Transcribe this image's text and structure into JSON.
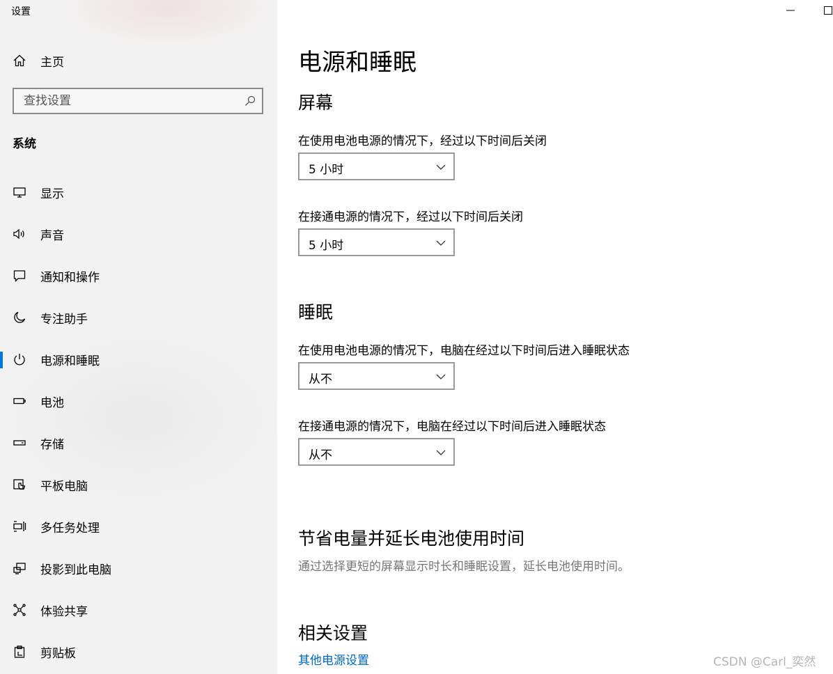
{
  "window": {
    "title": "设置"
  },
  "sidebar": {
    "home_label": "主页",
    "search_placeholder": "查找设置",
    "section_title": "系统",
    "items": [
      {
        "label": "显示",
        "icon": "display-icon"
      },
      {
        "label": "声音",
        "icon": "speaker-icon"
      },
      {
        "label": "通知和操作",
        "icon": "notification-icon"
      },
      {
        "label": "专注助手",
        "icon": "moon-icon"
      },
      {
        "label": "电源和睡眠",
        "icon": "power-icon",
        "active": true
      },
      {
        "label": "电池",
        "icon": "battery-icon"
      },
      {
        "label": "存储",
        "icon": "storage-icon"
      },
      {
        "label": "平板电脑",
        "icon": "tablet-icon"
      },
      {
        "label": "多任务处理",
        "icon": "multitask-icon"
      },
      {
        "label": "投影到此电脑",
        "icon": "project-icon"
      },
      {
        "label": "体验共享",
        "icon": "share-icon"
      },
      {
        "label": "剪贴板",
        "icon": "clipboard-icon"
      }
    ]
  },
  "main": {
    "title": "电源和睡眠",
    "screen": {
      "heading": "屏幕",
      "battery_label": "在使用电池电源的情况下，经过以下时间后关闭",
      "battery_value": "5 小时",
      "plugged_label": "在接通电源的情况下，经过以下时间后关闭",
      "plugged_value": "5 小时"
    },
    "sleep": {
      "heading": "睡眠",
      "battery_label": "在使用电池电源的情况下，电脑在经过以下时间后进入睡眠状态",
      "battery_value": "从不",
      "plugged_label": "在接通电源的情况下，电脑在经过以下时间后进入睡眠状态",
      "plugged_value": "从不"
    },
    "save": {
      "heading": "节省电量并延长电池使用时间",
      "description": "通过选择更短的屏幕显示时长和睡眠设置，延长电池使用时间。"
    },
    "related": {
      "heading": "相关设置",
      "link": "其他电源设置"
    }
  },
  "watermark": "CSDN @Carl_奕然",
  "colors": {
    "accent": "#0078d7",
    "link": "#0067c0",
    "sidebar_bg": "#f2f2f2"
  }
}
